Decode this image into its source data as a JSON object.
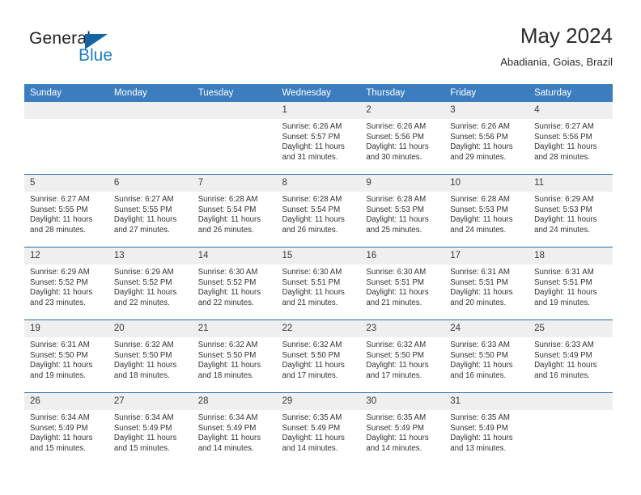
{
  "brand": {
    "name_top": "General",
    "name_bottom": "Blue",
    "accent_color": "#1f7fc4",
    "triangle_color": "#1463a3"
  },
  "header": {
    "title": "May 2024",
    "subtitle": "Abadiania, Goias, Brazil"
  },
  "theme": {
    "header_bg": "#3b7dbf",
    "week_divider": "#2c6cab",
    "daynum_bg": "#efefef",
    "text_color": "#333333"
  },
  "weekdays": [
    "Sunday",
    "Monday",
    "Tuesday",
    "Wednesday",
    "Thursday",
    "Friday",
    "Saturday"
  ],
  "weeks": [
    [
      {
        "day": "",
        "lines": []
      },
      {
        "day": "",
        "lines": []
      },
      {
        "day": "",
        "lines": []
      },
      {
        "day": "1",
        "lines": [
          "Sunrise: 6:26 AM",
          "Sunset: 5:57 PM",
          "Daylight: 11 hours",
          "and 31 minutes."
        ]
      },
      {
        "day": "2",
        "lines": [
          "Sunrise: 6:26 AM",
          "Sunset: 5:56 PM",
          "Daylight: 11 hours",
          "and 30 minutes."
        ]
      },
      {
        "day": "3",
        "lines": [
          "Sunrise: 6:26 AM",
          "Sunset: 5:56 PM",
          "Daylight: 11 hours",
          "and 29 minutes."
        ]
      },
      {
        "day": "4",
        "lines": [
          "Sunrise: 6:27 AM",
          "Sunset: 5:56 PM",
          "Daylight: 11 hours",
          "and 28 minutes."
        ]
      }
    ],
    [
      {
        "day": "5",
        "lines": [
          "Sunrise: 6:27 AM",
          "Sunset: 5:55 PM",
          "Daylight: 11 hours",
          "and 28 minutes."
        ]
      },
      {
        "day": "6",
        "lines": [
          "Sunrise: 6:27 AM",
          "Sunset: 5:55 PM",
          "Daylight: 11 hours",
          "and 27 minutes."
        ]
      },
      {
        "day": "7",
        "lines": [
          "Sunrise: 6:28 AM",
          "Sunset: 5:54 PM",
          "Daylight: 11 hours",
          "and 26 minutes."
        ]
      },
      {
        "day": "8",
        "lines": [
          "Sunrise: 6:28 AM",
          "Sunset: 5:54 PM",
          "Daylight: 11 hours",
          "and 26 minutes."
        ]
      },
      {
        "day": "9",
        "lines": [
          "Sunrise: 6:28 AM",
          "Sunset: 5:53 PM",
          "Daylight: 11 hours",
          "and 25 minutes."
        ]
      },
      {
        "day": "10",
        "lines": [
          "Sunrise: 6:28 AM",
          "Sunset: 5:53 PM",
          "Daylight: 11 hours",
          "and 24 minutes."
        ]
      },
      {
        "day": "11",
        "lines": [
          "Sunrise: 6:29 AM",
          "Sunset: 5:53 PM",
          "Daylight: 11 hours",
          "and 24 minutes."
        ]
      }
    ],
    [
      {
        "day": "12",
        "lines": [
          "Sunrise: 6:29 AM",
          "Sunset: 5:52 PM",
          "Daylight: 11 hours",
          "and 23 minutes."
        ]
      },
      {
        "day": "13",
        "lines": [
          "Sunrise: 6:29 AM",
          "Sunset: 5:52 PM",
          "Daylight: 11 hours",
          "and 22 minutes."
        ]
      },
      {
        "day": "14",
        "lines": [
          "Sunrise: 6:30 AM",
          "Sunset: 5:52 PM",
          "Daylight: 11 hours",
          "and 22 minutes."
        ]
      },
      {
        "day": "15",
        "lines": [
          "Sunrise: 6:30 AM",
          "Sunset: 5:51 PM",
          "Daylight: 11 hours",
          "and 21 minutes."
        ]
      },
      {
        "day": "16",
        "lines": [
          "Sunrise: 6:30 AM",
          "Sunset: 5:51 PM",
          "Daylight: 11 hours",
          "and 21 minutes."
        ]
      },
      {
        "day": "17",
        "lines": [
          "Sunrise: 6:31 AM",
          "Sunset: 5:51 PM",
          "Daylight: 11 hours",
          "and 20 minutes."
        ]
      },
      {
        "day": "18",
        "lines": [
          "Sunrise: 6:31 AM",
          "Sunset: 5:51 PM",
          "Daylight: 11 hours",
          "and 19 minutes."
        ]
      }
    ],
    [
      {
        "day": "19",
        "lines": [
          "Sunrise: 6:31 AM",
          "Sunset: 5:50 PM",
          "Daylight: 11 hours",
          "and 19 minutes."
        ]
      },
      {
        "day": "20",
        "lines": [
          "Sunrise: 6:32 AM",
          "Sunset: 5:50 PM",
          "Daylight: 11 hours",
          "and 18 minutes."
        ]
      },
      {
        "day": "21",
        "lines": [
          "Sunrise: 6:32 AM",
          "Sunset: 5:50 PM",
          "Daylight: 11 hours",
          "and 18 minutes."
        ]
      },
      {
        "day": "22",
        "lines": [
          "Sunrise: 6:32 AM",
          "Sunset: 5:50 PM",
          "Daylight: 11 hours",
          "and 17 minutes."
        ]
      },
      {
        "day": "23",
        "lines": [
          "Sunrise: 6:32 AM",
          "Sunset: 5:50 PM",
          "Daylight: 11 hours",
          "and 17 minutes."
        ]
      },
      {
        "day": "24",
        "lines": [
          "Sunrise: 6:33 AM",
          "Sunset: 5:50 PM",
          "Daylight: 11 hours",
          "and 16 minutes."
        ]
      },
      {
        "day": "25",
        "lines": [
          "Sunrise: 6:33 AM",
          "Sunset: 5:49 PM",
          "Daylight: 11 hours",
          "and 16 minutes."
        ]
      }
    ],
    [
      {
        "day": "26",
        "lines": [
          "Sunrise: 6:34 AM",
          "Sunset: 5:49 PM",
          "Daylight: 11 hours",
          "and 15 minutes."
        ]
      },
      {
        "day": "27",
        "lines": [
          "Sunrise: 6:34 AM",
          "Sunset: 5:49 PM",
          "Daylight: 11 hours",
          "and 15 minutes."
        ]
      },
      {
        "day": "28",
        "lines": [
          "Sunrise: 6:34 AM",
          "Sunset: 5:49 PM",
          "Daylight: 11 hours",
          "and 14 minutes."
        ]
      },
      {
        "day": "29",
        "lines": [
          "Sunrise: 6:35 AM",
          "Sunset: 5:49 PM",
          "Daylight: 11 hours",
          "and 14 minutes."
        ]
      },
      {
        "day": "30",
        "lines": [
          "Sunrise: 6:35 AM",
          "Sunset: 5:49 PM",
          "Daylight: 11 hours",
          "and 14 minutes."
        ]
      },
      {
        "day": "31",
        "lines": [
          "Sunrise: 6:35 AM",
          "Sunset: 5:49 PM",
          "Daylight: 11 hours",
          "and 13 minutes."
        ]
      },
      {
        "day": "",
        "lines": []
      }
    ]
  ]
}
